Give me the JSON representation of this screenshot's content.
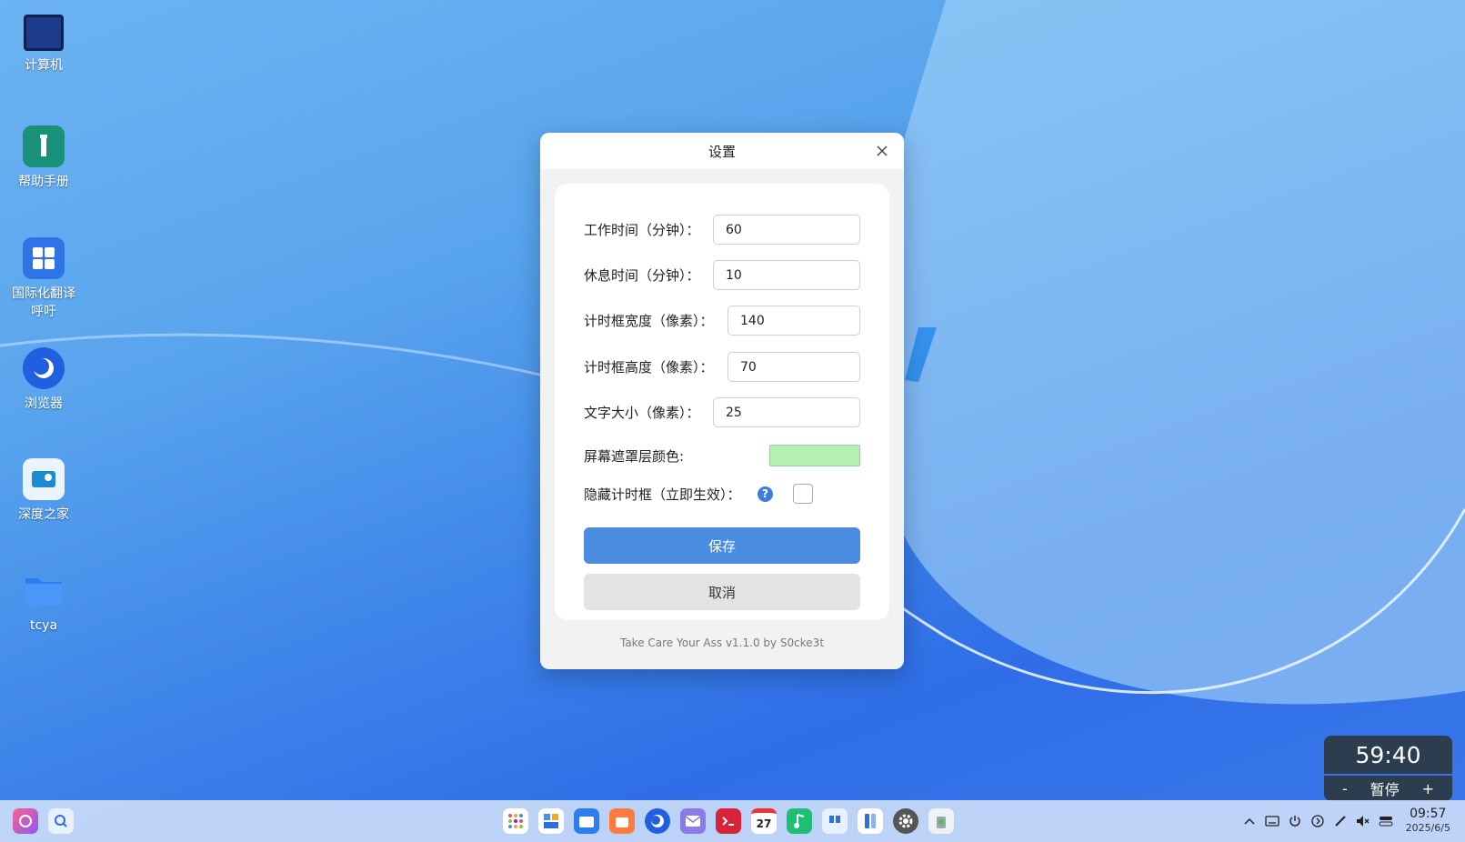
{
  "desktop": {
    "icons": [
      {
        "label": "计算机"
      },
      {
        "label": "帮助手册"
      },
      {
        "label": "国际化翻译\n呼吁"
      },
      {
        "label": "浏览器"
      },
      {
        "label": "深度之家"
      },
      {
        "label": "tcya"
      }
    ]
  },
  "dialog": {
    "title": "设置",
    "fields": [
      {
        "label": "工作时间（分钟）：",
        "value": "60"
      },
      {
        "label": "休息时间（分钟）：",
        "value": "10"
      },
      {
        "label": "计时框宽度（像素）：",
        "value": "140"
      },
      {
        "label": "计时框高度（像素）：",
        "value": "70"
      },
      {
        "label": "文字大小（像素）：",
        "value": "25"
      }
    ],
    "mask_color": {
      "label": "屏幕遮罩层颜色:",
      "color": "#b5f0b0"
    },
    "hide_timer": {
      "label": "隐藏计时框（立即生效）：",
      "help": "?",
      "checked": false
    },
    "save_label": "保存",
    "cancel_label": "取消",
    "footer": "Take Care Your Ass v1.1.0  by S0cke3t"
  },
  "timer_widget": {
    "time": "59:40",
    "minus": "-",
    "pause": "暂停",
    "plus": "+"
  },
  "taskbar": {
    "calendar_day": "27",
    "clock_time": "09:57",
    "clock_date": "2025/6/5"
  }
}
